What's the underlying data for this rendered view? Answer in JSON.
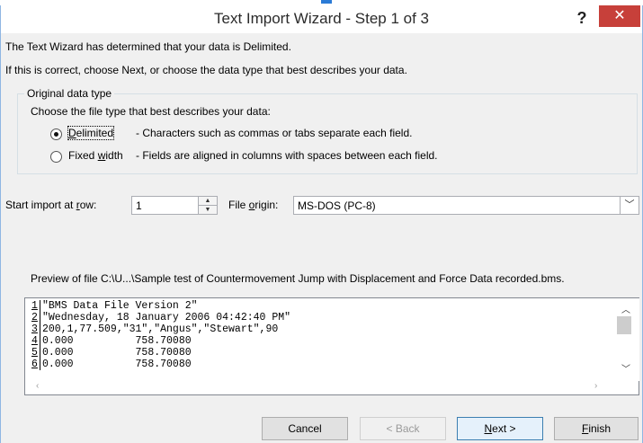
{
  "window": {
    "title": "Text Import Wizard - Step 1 of 3",
    "help_label": "?",
    "close_label": "✕"
  },
  "intro": {
    "line1": "The Text Wizard has determined that your data is Delimited.",
    "line2": "If this is correct, choose Next, or choose the data type that best describes your data."
  },
  "original_data_type": {
    "legend": "Original data type",
    "prompt": "Choose the file type that best describes your data:",
    "options": [
      {
        "label_pre": "",
        "label_key": "D",
        "label_post": "elimited",
        "description": "- Characters such as commas or tabs separate each field.",
        "selected": true
      },
      {
        "label_pre": "Fixed ",
        "label_key": "w",
        "label_post": "idth",
        "description": "- Fields are aligned in columns with spaces between each field.",
        "selected": false
      }
    ]
  },
  "start_row": {
    "label_pre": "Start import at ",
    "label_key": "r",
    "label_post": "ow:",
    "value": "1"
  },
  "file_origin": {
    "label_pre": "File ",
    "label_key": "o",
    "label_post": "rigin:",
    "value": "MS-DOS (PC-8)"
  },
  "preview": {
    "caption": "Preview of file C:\\U...\\Sample test of Countermovement Jump with Displacement and Force Data recorded.bms.",
    "lines": [
      {
        "num": "1",
        "text": "\"BMS Data File Version 2\""
      },
      {
        "num": "2",
        "text": "\"Wednesday, 18 January 2006 04:42:40 PM\""
      },
      {
        "num": "3",
        "text": "200,1,77.509,\"31\",\"Angus\",\"Stewart\",90"
      },
      {
        "num": "4",
        "text": "0.000          758.70080"
      },
      {
        "num": "5",
        "text": "0.000          758.70080"
      },
      {
        "num": "6",
        "text": "0.000          758.70080"
      }
    ]
  },
  "buttons": {
    "cancel": "Cancel",
    "back": "< Back",
    "next_key": "N",
    "next_post": "ext >",
    "finish_key": "F",
    "finish_post": "inish"
  }
}
